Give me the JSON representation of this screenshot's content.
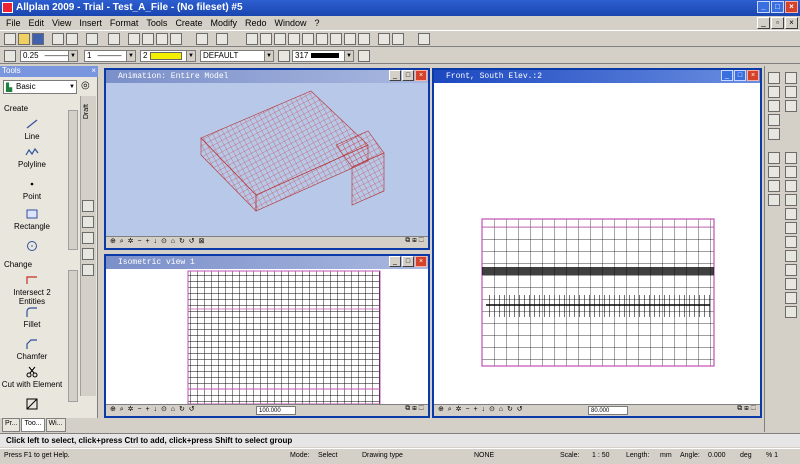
{
  "app": {
    "title": "Allplan 2009 - Trial - Test_A_File - (No fileset) #5"
  },
  "menu": [
    "File",
    "Edit",
    "View",
    "Insert",
    "Format",
    "Tools",
    "Create",
    "Modify",
    "Redo",
    "Window",
    "?"
  ],
  "props": {
    "pen": "0.25",
    "line": "1",
    "color": "2",
    "layer": "DEFAULT",
    "fill": "317"
  },
  "tools": {
    "header": "Tools",
    "module": "Basic",
    "vertical_tab": "Draft",
    "create_label": "Create",
    "create_items": [
      "Line",
      "Polyline",
      "Point",
      "Rectangle"
    ],
    "change_label": "Change",
    "change_items": [
      "Intersect 2 Entities",
      "Fillet",
      "Chamfer",
      "Cut with Element"
    ],
    "tabs": [
      "Pr...",
      "Too...",
      "Wi..."
    ]
  },
  "windows": {
    "animation": {
      "title": "Animation: Entire Model"
    },
    "isometric": {
      "title": "Isometric view 1",
      "scale": "100.000"
    },
    "front": {
      "title": "Front, South Elev.:2",
      "scale": "80.000"
    }
  },
  "hint": "Click left to select, click+press Ctrl to add, click+press Shift to select group",
  "status": {
    "help": "Press F1 to get Help.",
    "mode_label": "Mode:",
    "mode_value": "Select",
    "drawing_type_label": "Drawing type",
    "drawing_type_value": "NONE",
    "scale_label": "Scale:",
    "scale_value": "1 : 50",
    "length_label": "Length:",
    "length_unit": "mm",
    "angle_label": "Angle:",
    "angle_value": "0.000",
    "angle_unit": "deg",
    "percent": "% 1"
  },
  "colors": {
    "title_blue": "#1a45b0",
    "wire_red": "#c9302c",
    "viewport_sky": "#b7c8e8"
  }
}
